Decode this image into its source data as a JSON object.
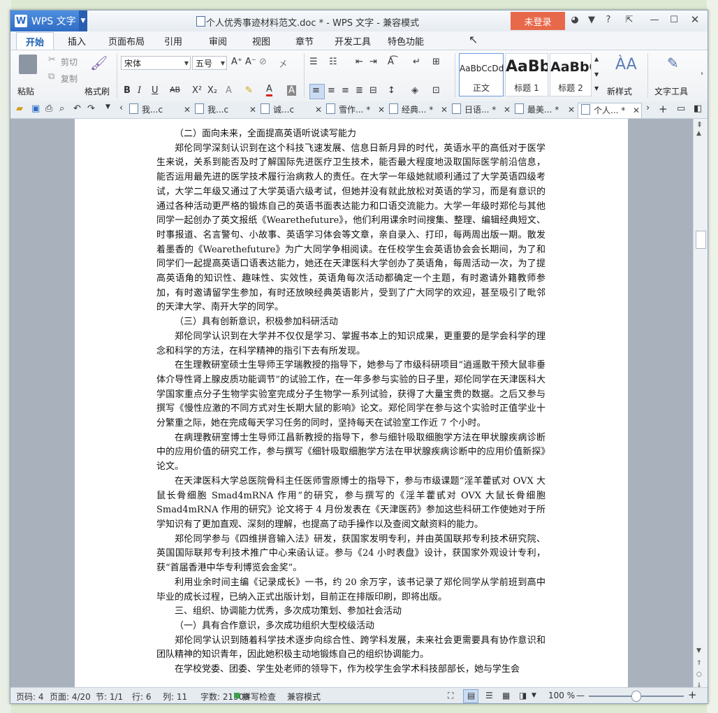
{
  "app": {
    "name": "WPS 文字",
    "doc_title": "个人优秀事迹材料范文.doc * - WPS 文字 - 兼容模式",
    "login": "未登录",
    "help": "?"
  },
  "menu": {
    "tabs": [
      "开始",
      "插入",
      "页面布局",
      "引用",
      "审阅",
      "视图",
      "章节",
      "开发工具",
      "特色功能"
    ]
  },
  "ribbon": {
    "paste": "粘贴",
    "cut": "剪切",
    "copy": "复制",
    "format_painter": "格式刷",
    "font_name": "宋体",
    "font_size": "五号",
    "styles": [
      {
        "sample": "AaBbCcDd",
        "name": "正文"
      },
      {
        "sample": "AaBb",
        "name": "标题 1"
      },
      {
        "sample": "AaBbC",
        "name": "标题 2"
      }
    ],
    "new_style": "新样式",
    "text_tools": "文字工具"
  },
  "doc_tabs": [
    "我...c",
    "我...c",
    "诚...c",
    "雪作... *",
    "经典... *",
    "日语... *",
    "最美... *",
    "个人... *"
  ],
  "document": {
    "paragraphs": [
      {
        "text": "（二）面向未来，全面提高英语听说读写能力",
        "indent": true
      },
      {
        "text": "郑伦同学深刻认识到在这个科技飞速发展、信息日新月异的时代，英语水平的高低对于医学生来说，关系到能否及时了解国际先进医疗卫生技术，能否最大程度地汲取国际医学前沿信息，能否运用最先进的医学技术履行治病救人的责任。在大学一年级她就顺利通过了大学英语四级考试，大学二年级又通过了大学英语六级考试，但她并没有就此放松对英语的学习，而是有意识的通过各种活动更严格的锻炼自己的英语书面表达能力和口语交流能力。大学一年级时郑伦与其他同学一起创办了英文报纸《Wearethefuture》，他们利用课余时间搜集、整理、编辑经典短文、时事报道、名言警句、小故事、英语学习体会等文章，亲自录入、打印，每两周出版一期。散发着墨香的《Wearethefuture》为广大同学争相阅读。在任校学生会英语协会会长期间，为了和同学们一起提高英语口语表达能力，她还在天津医科大学创办了英语角，每周活动一次，为了提高英语角的知识性、趣味性、实效性，英语角每次活动都确定一个主题，有时邀请外籍教师参加，有时邀请留学生参加，有时还放映经典英语影片，受到了广大同学的欢迎，甚至吸引了毗邻的天津大学、南开大学的同学。",
        "indent": true
      },
      {
        "text": "（三）具有创新意识，积极参加科研活动",
        "indent": true
      },
      {
        "text": "郑伦同学认识到在大学并不仅仅是学习、掌握书本上的知识成果，更重要的是学会科学的理念和科学的方法，在科学精神的指引下去有所发现。",
        "indent": true
      },
      {
        "text": "在生理教研室硕士生导师王学瑞教授的指导下，她参与了市级科研项目“逍遥散干预大鼠非垂体介导性肾上腺皮质功能调节”的试验工作，在一年多参与实验的日子里，郑伦同学在天津医科大学国家重点分子生物学实验室完成分子生物学一系列试验，获得了大量宝贵的数据。之后又参与撰写《慢性应激的不同方式对生长期大鼠的影响》论文。郑伦同学在参与这个实验时正值学业十分繁重之际，她在完成每天学习任务的同时，坚持每天在试验室工作近 7 个小时。",
        "indent": true
      },
      {
        "text": "在病理教研室博士生导师江昌新教授的指导下，参与细针吸取细胞学方法在甲状腺疾病诊断中的应用价值的研究工作，参与撰写《细针吸取细胞学方法在甲状腺疾病诊断中的应用价值新探》论文。",
        "indent": true
      },
      {
        "text": "在天津医科大学总医院骨科主任医师雪原博士的指导下，参与市级课题“淫羊藿甙对 OVX 大鼠长骨细胞 Smad4mRNA 作用”的研究，参与撰写的《淫羊藿甙对 OVX 大鼠长骨细胞 Smad4mRNA 作用的研究》论文将于 4 月份发表在《天津医药》参加这些科研工作使她对于所学知识有了更加直观、深刻的理解，也提高了动手操作以及查阅文献资料的能力。",
        "indent": true
      },
      {
        "text": "郑伦同学参与《四维拼音输入法》研发，获国家发明专利，并由英国联邦专利技术研究院、英国国际联邦专利技术推广中心来函认证。参与《24 小时表盘》设计，获国家外观设计专利，获“首届香港中华专利博览会金奖”。",
        "indent": true
      },
      {
        "text": "利用业余时间主编《记录成长》一书，约 20 余万字，该书记录了郑伦同学从学前班到高中毕业的成长过程，已纳入正式出版计划，目前正在排版印刷，即将出版。",
        "indent": true
      },
      {
        "text": "三、组织、协调能力优秀，多次成功策划、参加社会活动",
        "indent": true
      },
      {
        "text": "（一）具有合作意识，多次成功组织大型校级活动",
        "indent": true
      },
      {
        "text": "郑伦同学认识到随着科学技术逐步向综合性、跨学科发展，未来社会更需要具有协作意识和团队精神的知识青年，因此她积极主动地锻炼自己的组织协调能力。",
        "indent": true
      },
      {
        "text": "在学校党委、团委、学生处老师的领导下，作为校学生会学术科技部部长，她与学生会",
        "indent": true
      }
    ]
  },
  "status": {
    "page": "页码: 4",
    "pages": "页面: 4/20",
    "section": "节: 1/1",
    "row": "行: 6",
    "col": "列: 11",
    "words": "字数: 21308",
    "spell": "拼写检查",
    "mode": "兼容模式",
    "zoom": "100 %",
    "zoom_fraction": 0.5
  },
  "colors": {
    "accent": "#2f6cc5",
    "login": "#e8694a"
  }
}
